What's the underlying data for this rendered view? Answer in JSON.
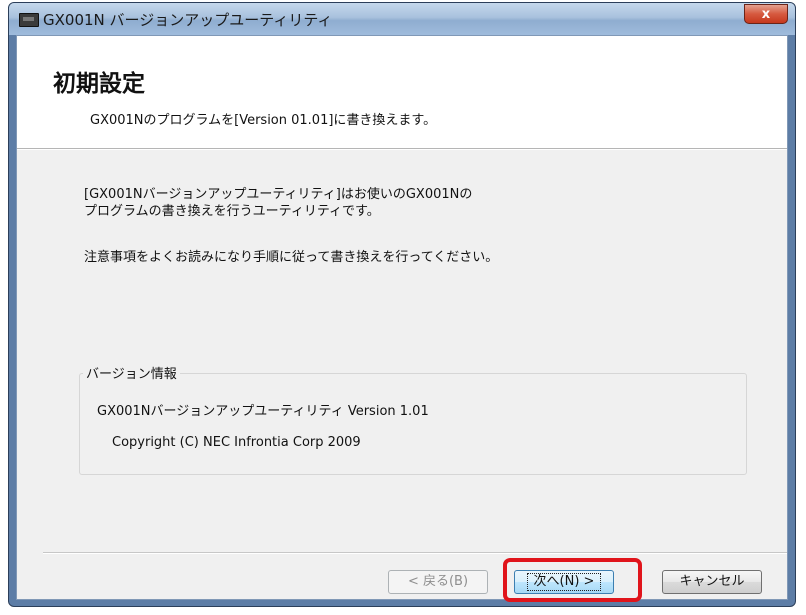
{
  "window": {
    "title": "GX001N バージョンアップユーティリティ",
    "close_label": "x"
  },
  "header": {
    "title": "初期設定",
    "subtitle": "GX001Nのプログラムを[Version 01.01]に書き換えます。"
  },
  "body": {
    "paragraph1_line1": "[GX001Nバージョンアップユーティリティ]はお使いのGX001Nの",
    "paragraph1_line2": "プログラムの書き換えを行うユーティリティです。",
    "paragraph2": "注意事項をよくお読みになり手順に従って書き換えを行ってください。"
  },
  "version_info": {
    "label": "バージョン情報",
    "version": "GX001Nバージョンアップユーティリティ Version 1.01",
    "copyright": "Copyright (C) NEC Infrontia Corp 2009"
  },
  "buttons": {
    "back": "< 戻る(B)",
    "next": "次へ(N) >",
    "cancel": "キャンセル"
  },
  "colors": {
    "highlight": "#e0141b"
  }
}
